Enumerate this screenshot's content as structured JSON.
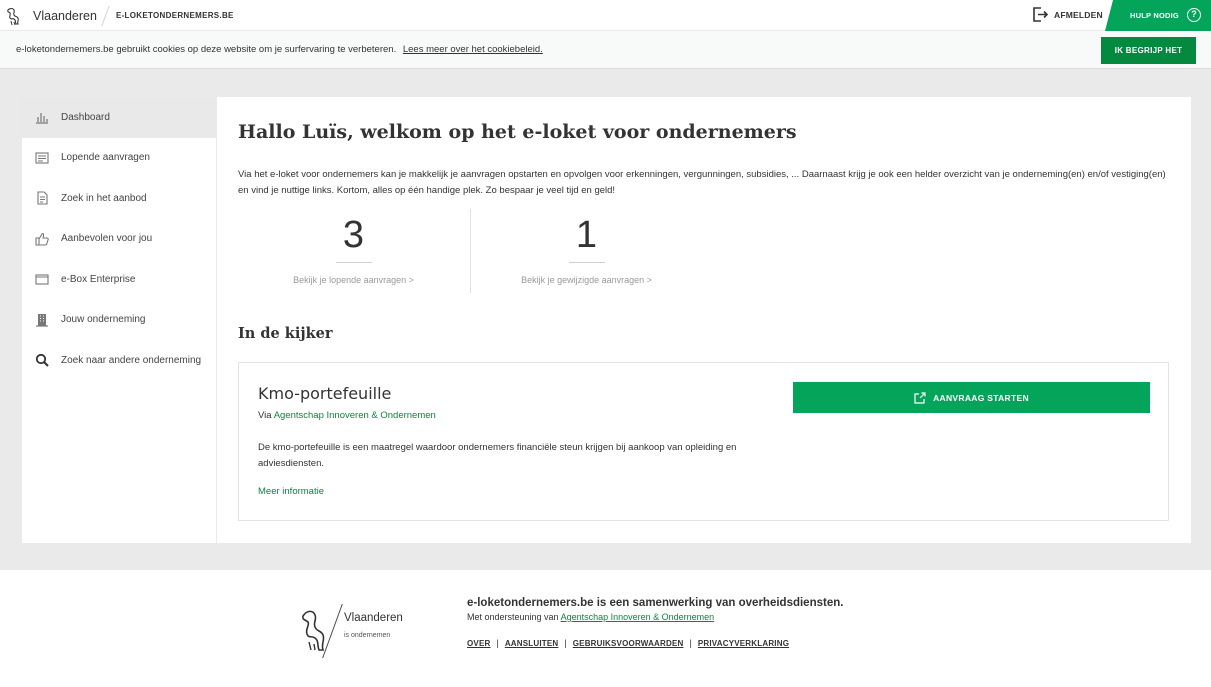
{
  "header": {
    "brand": "Vlaanderen",
    "site": "E-LOKETONDERNEMERS.BE",
    "logout": "AFMELDEN",
    "help": "HULP NODIG"
  },
  "cookie": {
    "text": "e-loketondernemers.be gebruikt cookies op deze website om je surfervaring te verbeteren.",
    "link": "Lees meer over het cookiebeleid.",
    "accept": "IK BEGRIJP HET"
  },
  "sidebar": {
    "items": [
      {
        "label": "Dashboard",
        "icon": "chart-icon"
      },
      {
        "label": "Lopende aanvragen",
        "icon": "list-icon"
      },
      {
        "label": "Zoek in het aanbod",
        "icon": "document-icon"
      },
      {
        "label": "Aanbevolen voor jou",
        "icon": "thumbs-up-icon"
      },
      {
        "label": "e-Box Enterprise",
        "icon": "inbox-icon"
      },
      {
        "label": "Jouw onderneming",
        "icon": "building-icon"
      },
      {
        "label": "Zoek naar andere onderneming",
        "icon": "search-icon"
      }
    ]
  },
  "main": {
    "title": "Hallo Luïs, welkom op het e-loket voor ondernemers",
    "intro": "Via het e-loket voor ondernemers kan je makkelijk je aanvragen opstarten en opvolgen voor erkenningen, vergunningen, subsidies, ... Daarnaast krijg je ook een helder overzicht van je onderneming(en) en/of vestiging(en) en vind je nuttige links. Kortom, alles op één handige plek. Zo bespaar je veel tijd en geld!",
    "stats": [
      {
        "value": "3",
        "link": "Bekijk je lopende aanvragen >"
      },
      {
        "value": "1",
        "link": "Bekijk je gewijzigde aanvragen >"
      }
    ],
    "section_title": "In de kijker",
    "card": {
      "title": "Kmo-portefeuille",
      "via_prefix": "Via",
      "via_link": "Agentschap Innoveren & Ondernemen",
      "description": "De kmo-portefeuille is een maatregel waardoor ondernemers financiële steun krijgen bij aankoop van opleiding en adviesdiensten.",
      "more": "Meer informatie",
      "button": "AANVRAAG STARTEN"
    }
  },
  "footer": {
    "brand": "Vlaanderen",
    "tagline": "is ondernemen",
    "title": "e-loketondernemers.be is een samenwerking van overheidsdiensten.",
    "support_prefix": "Met ondersteuning van",
    "support_link": "Agentschap Innoveren & Ondernemen",
    "links": [
      "OVER",
      "AANSLUITEN",
      "GEBRUIKSVOORWAARDEN",
      "PRIVACYVERKLARING"
    ]
  },
  "colors": {
    "accent": "#05a45b",
    "accent_dark": "#04893f",
    "background": "#eaeaea"
  }
}
